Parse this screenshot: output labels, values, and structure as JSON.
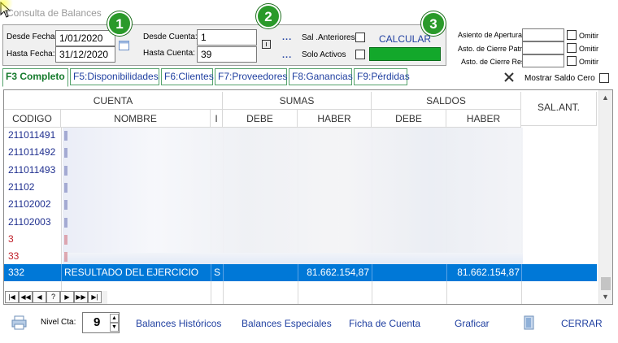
{
  "window": {
    "title": "Consulta de Balances"
  },
  "filters": {
    "desde_fecha_label": "Desde Fecha:",
    "desde_fecha_value": "1/01/2020",
    "hasta_fecha_label": "Hasta Fecha:",
    "hasta_fecha_value": "31/12/2020",
    "desde_cuenta_label": "Desde Cuenta:",
    "desde_cuenta_value": "1",
    "hasta_cuenta_label": "Hasta Cuenta:",
    "hasta_cuenta_value": "39",
    "dots": "...",
    "sal_anteriores_label": "Sal .Anteriores:",
    "solo_activos_label": "Solo Activos",
    "calcular_label": "CALCULAR"
  },
  "badges": [
    "1",
    "2",
    "3"
  ],
  "asientos": {
    "apertura_label": "Asiento de Apertura",
    "cierre_patr_label": "Asto. de Cierre Patr.",
    "cierre_res_label": "Asto. de Cierre Res.",
    "omitir_label": "Omitir"
  },
  "tabs": [
    {
      "label": "F3 Completo"
    },
    {
      "label": "F5:Disponibilidades"
    },
    {
      "label": "F6:Clientes"
    },
    {
      "label": "F7:Proveedores"
    },
    {
      "label": "F8:Ganancias"
    },
    {
      "label": "F9:Pérdidas"
    }
  ],
  "mostrar_saldo_cero_label": "Mostrar Saldo Cero",
  "grid": {
    "headers": {
      "cuenta": "CUENTA",
      "sumas": "SUMAS",
      "saldos": "SALDOS",
      "sal_ant": "SAL.ANT.",
      "codigo": "CODIGO",
      "nombre": "NOMBRE",
      "i": "I",
      "debe": "DEBE",
      "haber": "HABER"
    },
    "rows": [
      {
        "codigo": "211011491",
        "color": "#1f2f8f"
      },
      {
        "codigo": "211011492",
        "color": "#1f2f8f"
      },
      {
        "codigo": "211011493",
        "color": "#1f2f8f"
      },
      {
        "codigo": "21102",
        "color": "#1f2f8f"
      },
      {
        "codigo": "21102002",
        "color": "#1f2f8f"
      },
      {
        "codigo": "21102003",
        "color": "#1f2f8f"
      },
      {
        "codigo": "3",
        "color": "#c0202a"
      },
      {
        "codigo": "33",
        "color": "#c0202a"
      }
    ],
    "selected_row": {
      "codigo": "332",
      "nombre": "RESULTADO DEL EJERCICIO",
      "i": "S",
      "sumas_haber": "81.662.154,87",
      "saldos_haber": "81.662.154,87"
    }
  },
  "bottom": {
    "nivel_cta_label": "Nivel Cta:",
    "nivel_cta_value": "9",
    "balances_historicos": "Balances Históricos",
    "balances_especiales": "Balances Especiales",
    "ficha_de_cuenta": "Ficha de Cuenta",
    "graficar": "Graficar",
    "cerrar": "CERRAR"
  },
  "colors": {
    "selection": "#0078d7",
    "link": "#1f3fa0",
    "badge": "#2a9a2a",
    "accent_green": "#13a82b"
  }
}
